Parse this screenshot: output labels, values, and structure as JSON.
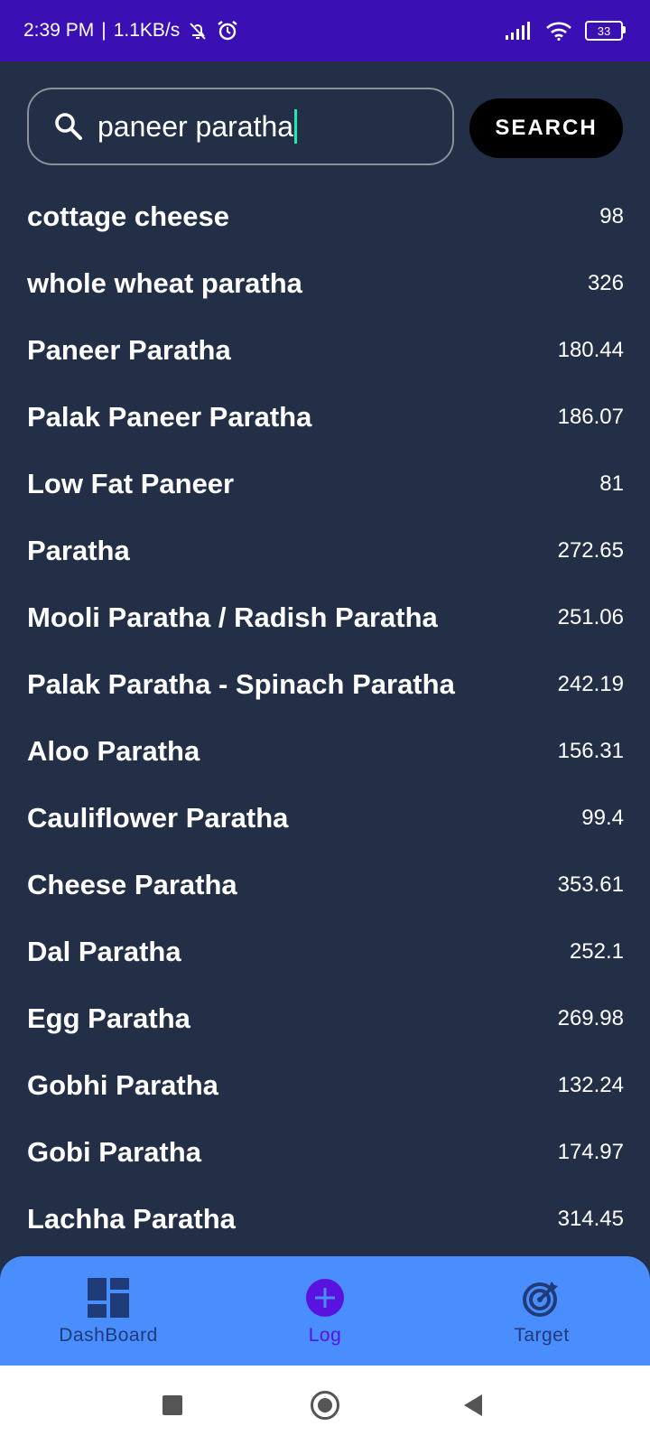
{
  "status_bar": {
    "time": "2:39 PM",
    "separator": "|",
    "speed": "1.1KB/s",
    "battery": "33",
    "icons": [
      "mute-bell-icon",
      "alarm-icon",
      "signal-icon",
      "wifi-icon",
      "battery-icon"
    ]
  },
  "search": {
    "value": "paneer paratha",
    "button_label": "SEARCH",
    "icon": "search-icon"
  },
  "results": [
    {
      "name": "cottage cheese",
      "calories": "98"
    },
    {
      "name": "whole wheat paratha",
      "calories": "326"
    },
    {
      "name": "Paneer Paratha",
      "calories": "180.44"
    },
    {
      "name": "Palak Paneer Paratha",
      "calories": "186.07"
    },
    {
      "name": "Low Fat Paneer",
      "calories": "81"
    },
    {
      "name": "Paratha",
      "calories": "272.65"
    },
    {
      "name": "Mooli Paratha / Radish Paratha",
      "calories": "251.06"
    },
    {
      "name": "Palak Paratha - Spinach Paratha",
      "calories": "242.19"
    },
    {
      "name": "Aloo Paratha",
      "calories": "156.31"
    },
    {
      "name": "Cauliflower Paratha",
      "calories": "99.4"
    },
    {
      "name": "Cheese Paratha",
      "calories": "353.61"
    },
    {
      "name": "Dal Paratha",
      "calories": "252.1"
    },
    {
      "name": "Egg Paratha",
      "calories": "269.98"
    },
    {
      "name": "Gobhi Paratha",
      "calories": "132.24"
    },
    {
      "name": "Gobi Paratha",
      "calories": "174.97"
    },
    {
      "name": "Lachha Paratha",
      "calories": "314.45"
    }
  ],
  "bottom_nav": {
    "items": [
      {
        "label": "DashBoard",
        "icon": "dashboard-icon"
      },
      {
        "label": "Log",
        "icon": "add-circle-icon",
        "active": true
      },
      {
        "label": "Target",
        "icon": "target-icon"
      }
    ]
  },
  "colors": {
    "status_bar": "#3a0fb4",
    "background": "#232f46",
    "bottom_nav": "#4a8dfc",
    "active_nav": "#5a12e0",
    "caret": "#1de9b6"
  }
}
